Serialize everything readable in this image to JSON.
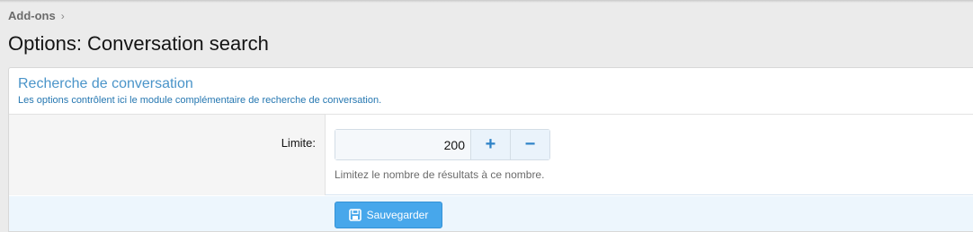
{
  "breadcrumb": {
    "item": "Add-ons",
    "separator": "›"
  },
  "page": {
    "title": "Options: Conversation search"
  },
  "block": {
    "title": "Recherche de conversation",
    "description": "Les options contrôlent ici le module complémentaire de recherche de conversation."
  },
  "option": {
    "label": "Limite:",
    "value": "200",
    "increment_label": "+",
    "decrement_label": "−",
    "hint": "Limitez le nombre de résultats à ce nombre."
  },
  "footer": {
    "save_label": "Sauvegarder",
    "save_icon": "save-icon"
  },
  "colors": {
    "accent": "#47a7eb",
    "title_blue": "#4a94c9"
  }
}
